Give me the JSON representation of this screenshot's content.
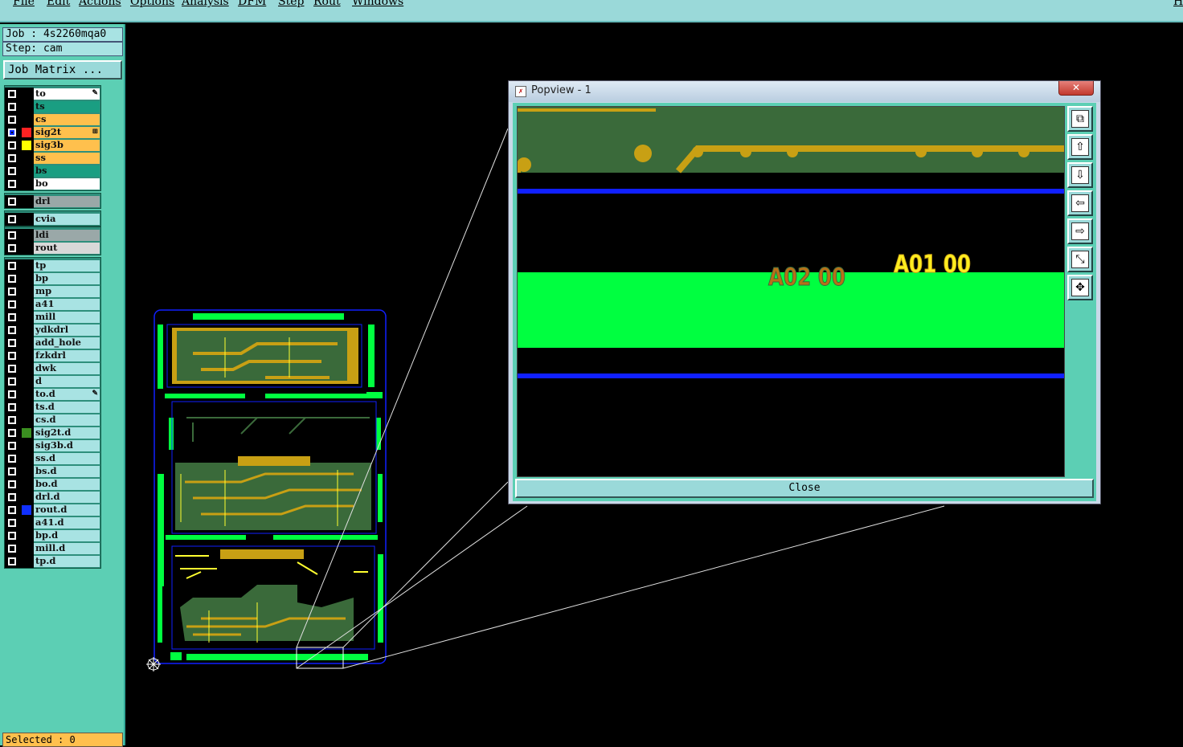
{
  "menu": [
    "File",
    "Edit",
    "Actions",
    "Options",
    "Analysis",
    "DFM",
    "Step",
    "Rout",
    "Windows"
  ],
  "menu_help": "H",
  "job": {
    "job_line": "Job : 4s2260mqa0",
    "step_line": "Step: cam",
    "matrix_button": "Job Matrix ..."
  },
  "layers": {
    "group1": [
      {
        "name": "to",
        "bg": "#ffffff",
        "swatch": "",
        "mark": "✎"
      },
      {
        "name": "ts",
        "bg": "#1a9e82",
        "swatch": "",
        "mark": ""
      },
      {
        "name": "cs",
        "bg": "#ffc04d",
        "swatch": "",
        "mark": ""
      },
      {
        "name": "sig2t",
        "bg": "#ffc04d",
        "swatch": "#ff2222",
        "mark": "⊞",
        "selected": true
      },
      {
        "name": "sig3b",
        "bg": "#ffc04d",
        "swatch": "#ffff00",
        "mark": ""
      },
      {
        "name": "ss",
        "bg": "#ffc04d",
        "swatch": "",
        "mark": ""
      },
      {
        "name": "bs",
        "bg": "#1a9e82",
        "swatch": "",
        "mark": ""
      },
      {
        "name": "bo",
        "bg": "#ffffff",
        "swatch": "",
        "mark": ""
      }
    ],
    "group2": [
      {
        "name": "drl",
        "bg": "#9aa8a8",
        "swatch": "",
        "mark": ""
      }
    ],
    "group3": [
      {
        "name": "cvia",
        "bg": "#a8e3e3",
        "swatch": "",
        "mark": ""
      }
    ],
    "group4": [
      {
        "name": "ldi",
        "bg": "#9aa8a8",
        "swatch": "",
        "mark": ""
      },
      {
        "name": "rout",
        "bg": "#d8d8d8",
        "swatch": "",
        "mark": ""
      }
    ],
    "group5": [
      {
        "name": "tp",
        "bg": "#a8e3e3",
        "swatch": "",
        "mark": ""
      },
      {
        "name": "bp",
        "bg": "#a8e3e3",
        "swatch": "",
        "mark": ""
      },
      {
        "name": "mp",
        "bg": "#a8e3e3",
        "swatch": "",
        "mark": ""
      },
      {
        "name": "a41",
        "bg": "#a8e3e3",
        "swatch": "",
        "mark": ""
      },
      {
        "name": "mill",
        "bg": "#a8e3e3",
        "swatch": "",
        "mark": ""
      },
      {
        "name": "ydkdrl",
        "bg": "#a8e3e3",
        "swatch": "",
        "mark": ""
      },
      {
        "name": "add_hole",
        "bg": "#a8e3e3",
        "swatch": "",
        "mark": ""
      },
      {
        "name": "fzkdrl",
        "bg": "#a8e3e3",
        "swatch": "",
        "mark": ""
      },
      {
        "name": "dwk",
        "bg": "#a8e3e3",
        "swatch": "",
        "mark": ""
      },
      {
        "name": "d",
        "bg": "#a8e3e3",
        "swatch": "",
        "mark": ""
      },
      {
        "name": "to.d",
        "bg": "#a8e3e3",
        "swatch": "",
        "mark": "✎"
      },
      {
        "name": "ts.d",
        "bg": "#a8e3e3",
        "swatch": "",
        "mark": ""
      },
      {
        "name": "cs.d",
        "bg": "#a8e3e3",
        "swatch": "",
        "mark": ""
      },
      {
        "name": "sig2t.d",
        "bg": "#a8e3e3",
        "swatch": "#3a8f20",
        "mark": ""
      },
      {
        "name": "sig3b.d",
        "bg": "#a8e3e3",
        "swatch": "",
        "mark": ""
      },
      {
        "name": "ss.d",
        "bg": "#a8e3e3",
        "swatch": "",
        "mark": ""
      },
      {
        "name": "bs.d",
        "bg": "#a8e3e3",
        "swatch": "",
        "mark": ""
      },
      {
        "name": "bo.d",
        "bg": "#a8e3e3",
        "swatch": "",
        "mark": ""
      },
      {
        "name": "drl.d",
        "bg": "#a8e3e3",
        "swatch": "",
        "mark": ""
      },
      {
        "name": "rout.d",
        "bg": "#a8e3e3",
        "swatch": "#1030ff",
        "mark": ""
      },
      {
        "name": "a41.d",
        "bg": "#a8e3e3",
        "swatch": "",
        "mark": ""
      },
      {
        "name": "bp.d",
        "bg": "#a8e3e3",
        "swatch": "",
        "mark": ""
      },
      {
        "name": "mill.d",
        "bg": "#a8e3e3",
        "swatch": "",
        "mark": ""
      },
      {
        "name": "tp.d",
        "bg": "#a8e3e3",
        "swatch": "",
        "mark": ""
      }
    ]
  },
  "status": "Selected : 0",
  "popview": {
    "title": "Popview - 1",
    "close_x": "✕",
    "close_label": "Close",
    "labels": {
      "left": "A02 00",
      "right": "A01 00"
    },
    "tool_icons": [
      "zoom-window-icon",
      "pan-up-icon",
      "pan-down-icon",
      "pan-left-icon",
      "pan-right-icon",
      "zoom-home-icon",
      "zoom-fit-icon"
    ]
  },
  "colors": {
    "panel": "#5ccfb4",
    "copper": "#c8a014",
    "board": "#3a6a3a",
    "outline": "#00ff40",
    "rout": "#1020ff",
    "highlight": "#ffff30"
  }
}
